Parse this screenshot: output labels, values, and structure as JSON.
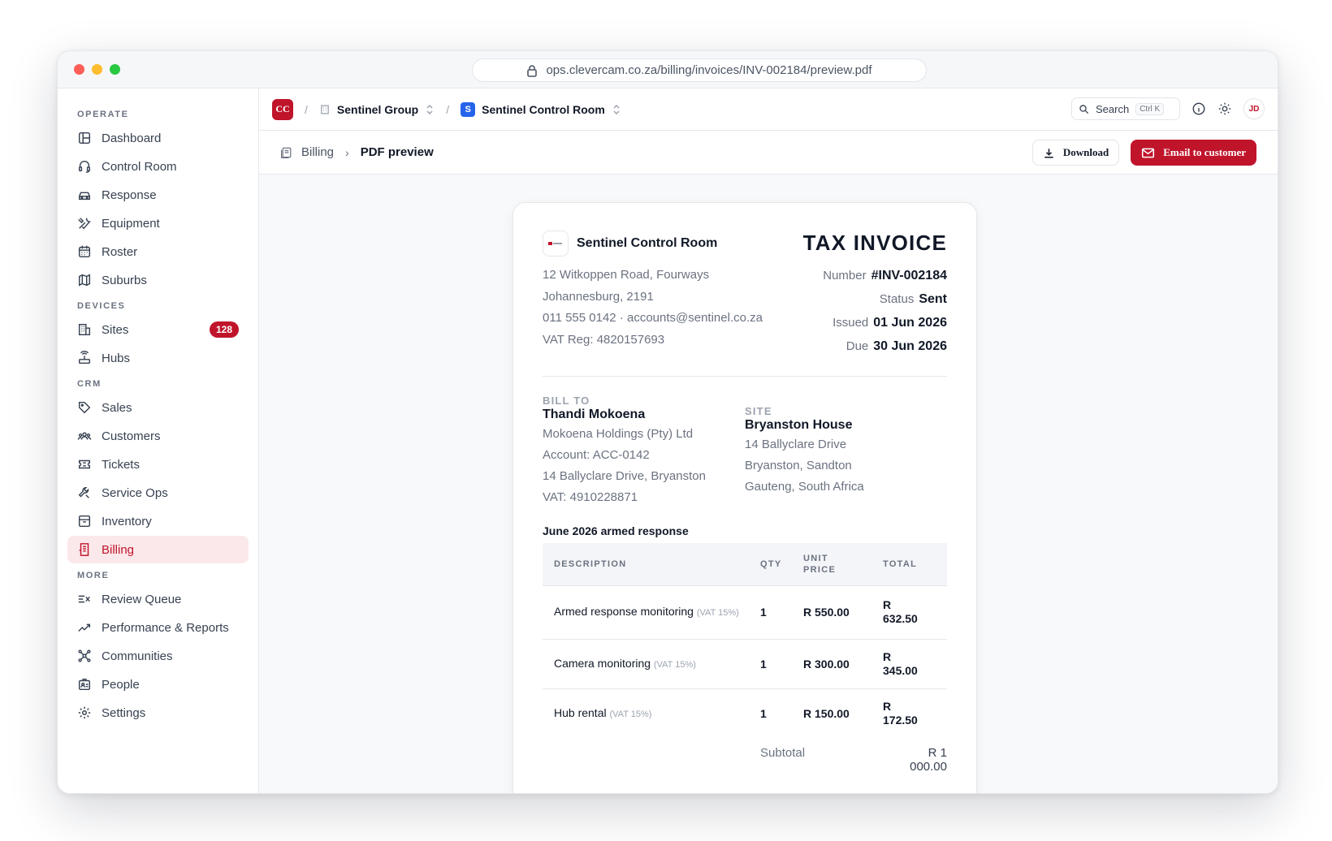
{
  "browser": {
    "url": "ops.clevercam.co.za/billing/invoices/INV-002184/preview.pdf",
    "colors": {
      "close": "#ff5f57",
      "minimize": "#febc2e",
      "maximize": "#28c840"
    }
  },
  "sidebar": {
    "sections": [
      {
        "label": "OPERATE",
        "items": [
          {
            "label": "Dashboard",
            "icon": "dashboard-icon"
          },
          {
            "label": "Control Room",
            "icon": "headset-icon"
          },
          {
            "label": "Response",
            "icon": "car-icon"
          },
          {
            "label": "Equipment",
            "icon": "tools-icon"
          },
          {
            "label": "Roster",
            "icon": "calendar-icon"
          },
          {
            "label": "Suburbs",
            "icon": "map-icon"
          }
        ]
      },
      {
        "label": "DEVICES",
        "items": [
          {
            "label": "Sites",
            "icon": "building-icon",
            "badge": "128"
          },
          {
            "label": "Hubs",
            "icon": "router-icon"
          }
        ]
      },
      {
        "label": "CRM",
        "items": [
          {
            "label": "Sales",
            "icon": "tag-icon"
          },
          {
            "label": "Customers",
            "icon": "users-icon"
          },
          {
            "label": "Tickets",
            "icon": "ticket-icon"
          },
          {
            "label": "Service Ops",
            "icon": "wrench-icon"
          },
          {
            "label": "Inventory",
            "icon": "archive-icon"
          },
          {
            "label": "Billing",
            "icon": "receipt-icon",
            "active": true
          }
        ]
      },
      {
        "label": "MORE",
        "items": [
          {
            "label": "Review Queue",
            "icon": "review-queue-icon"
          },
          {
            "label": "Performance & Reports",
            "icon": "trend-icon"
          },
          {
            "label": "Communities",
            "icon": "network-icon"
          },
          {
            "label": "People",
            "icon": "id-card-icon"
          },
          {
            "label": "Settings",
            "icon": "gear-icon"
          }
        ]
      }
    ],
    "accent": "#c0142b"
  },
  "topbar": {
    "logo": "CC",
    "org": "Sentinel Group",
    "workspace_logo": "S",
    "workspace": "Sentinel Control Room",
    "search_label": "Search",
    "search_shortcut": "Ctrl K",
    "avatar": "JD"
  },
  "pagebar": {
    "parent": "Billing",
    "current": "PDF preview",
    "download_label": "Download",
    "email_label": "Email to customer"
  },
  "invoice": {
    "company": "Sentinel Control Room",
    "address": [
      "12 Witkoppen Road, Fourways",
      "Johannesburg, 2191",
      "011 555 0142 · accounts@sentinel.co.za",
      "VAT Reg: 4820157693"
    ],
    "title": "TAX INVOICE",
    "meta": [
      {
        "label": "Number",
        "value": "#INV-002184"
      },
      {
        "label": "Status",
        "value": "Sent"
      },
      {
        "label": "Issued",
        "value": "01 Jun 2026"
      },
      {
        "label": "Due",
        "value": "30 Jun 2026"
      }
    ],
    "bill_to": {
      "label": "BILL TO",
      "name": "Thandi Mokoena",
      "lines": [
        "Mokoena Holdings (Pty) Ltd",
        "Account: ACC-0142",
        "14 Ballyclare Drive, Bryanston",
        "VAT: 4910228871"
      ]
    },
    "site": {
      "label": "SITE",
      "name": "Bryanston House",
      "lines": [
        "14 Ballyclare Drive",
        "Bryanston, Sandton",
        "Gauteng, South Africa"
      ]
    },
    "line_title": "June 2026 armed response",
    "columns": {
      "description": "DESCRIPTION",
      "qty": "QTY",
      "unit_price_1": "UNIT",
      "unit_price_2": "PRICE",
      "total": "TOTAL"
    },
    "rows": [
      {
        "desc": "Armed response monitoring",
        "vat": "(VAT 15%)",
        "qty": "1",
        "unit": "R 550.00",
        "total_1": "R",
        "total_2": "632.50"
      },
      {
        "desc": "Camera monitoring",
        "vat": "(VAT 15%)",
        "qty": "1",
        "unit": "R 300.00",
        "total_1": "R",
        "total_2": "345.00"
      },
      {
        "desc": "Hub rental",
        "vat": "(VAT 15%)",
        "qty": "1",
        "unit": "R 150.00",
        "total_1": "R",
        "total_2": "172.50"
      }
    ],
    "subtotal_label": "Subtotal",
    "subtotal_value": "R 1 000.00"
  }
}
